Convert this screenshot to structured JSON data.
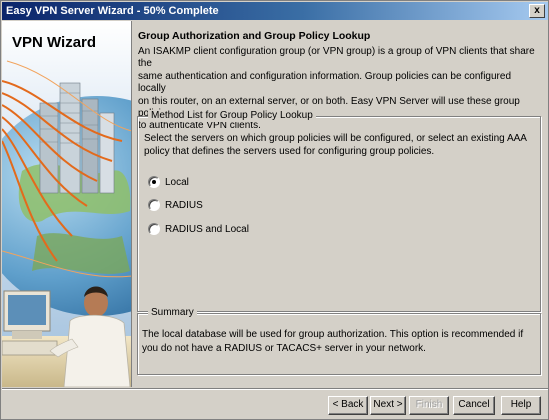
{
  "window": {
    "title": "Easy VPN Server Wizard - 50% Complete",
    "close_glyph": "x"
  },
  "side_panel": {
    "title": "VPN Wizard"
  },
  "content": {
    "heading": "Group Authorization and Group Policy Lookup",
    "intro_lines": [
      "An ISAKMP client configuration group (or VPN group) is a group of VPN clients that share the",
      "same authentication and configuration information. Group policies can be configured locally",
      "on this router, on an external server, or on both. Easy VPN Server will use these group policies",
      "to authenticate VPN clients."
    ],
    "method_group": {
      "legend": "Method List for Group Policy Lookup",
      "description_lines": [
        "Select the servers on which group policies will be configured, or select an existing AAA",
        "policy that defines the servers used for configuring group policies."
      ],
      "options": [
        {
          "label": "Local",
          "selected": true
        },
        {
          "label": "RADIUS",
          "selected": false
        },
        {
          "label": "RADIUS and Local",
          "selected": false
        }
      ]
    },
    "summary_group": {
      "legend": "Summary",
      "text_lines": [
        "The local database will be used for group authorization. This option is recommended if",
        "you do not have a RADIUS or TACACS+ server in your network."
      ]
    }
  },
  "buttons": {
    "back": "< Back",
    "next": "Next >",
    "finish": "Finish",
    "cancel": "Cancel",
    "help": "Help"
  }
}
